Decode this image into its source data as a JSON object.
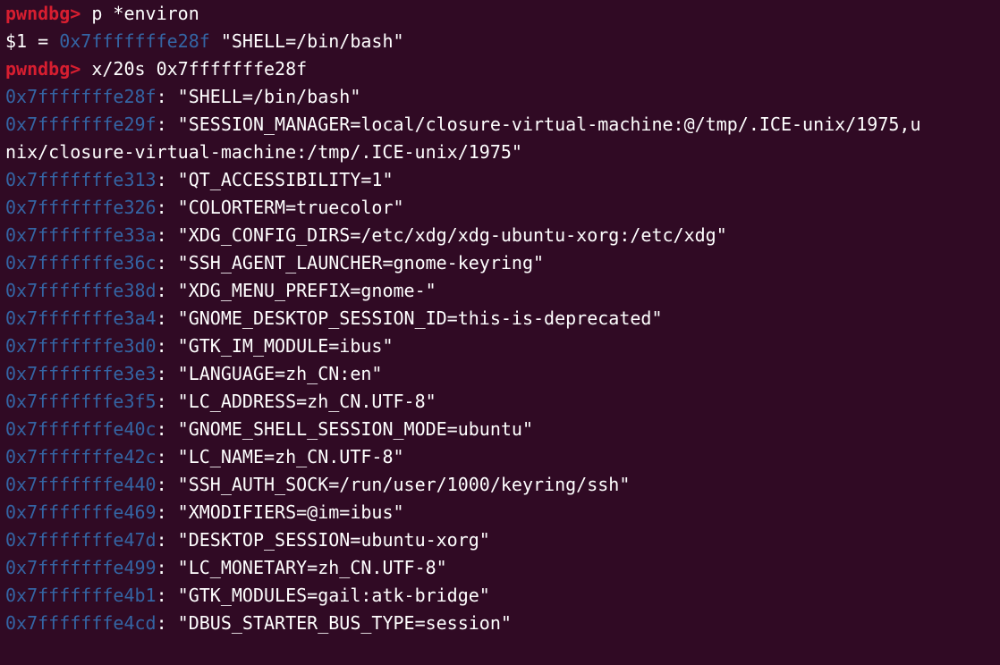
{
  "colors": {
    "background": "#300a24",
    "prompt": "#d71e30",
    "address": "#3465a4",
    "text": "#ffffff"
  },
  "session": [
    {
      "kind": "prompt",
      "prompt": "pwndbg> ",
      "command": "p *environ"
    },
    {
      "kind": "result",
      "prefix": "$1 = ",
      "addr": "0x7fffffffe28f",
      "value": " \"SHELL=/bin/bash\""
    },
    {
      "kind": "prompt",
      "prompt": "pwndbg> ",
      "command": "x/20s 0x7fffffffe28f"
    }
  ],
  "strings": [
    {
      "addr": "0x7fffffffe28f",
      "text": ": \"SHELL=/bin/bash\""
    },
    {
      "addr": "0x7fffffffe29f",
      "text": ": \"SESSION_MANAGER=local/closure-virtual-machine:@/tmp/.ICE-unix/1975,u"
    },
    {
      "addr": "",
      "text": "nix/closure-virtual-machine:/tmp/.ICE-unix/1975\""
    },
    {
      "addr": "0x7fffffffe313",
      "text": ": \"QT_ACCESSIBILITY=1\""
    },
    {
      "addr": "0x7fffffffe326",
      "text": ": \"COLORTERM=truecolor\""
    },
    {
      "addr": "0x7fffffffe33a",
      "text": ": \"XDG_CONFIG_DIRS=/etc/xdg/xdg-ubuntu-xorg:/etc/xdg\""
    },
    {
      "addr": "0x7fffffffe36c",
      "text": ": \"SSH_AGENT_LAUNCHER=gnome-keyring\""
    },
    {
      "addr": "0x7fffffffe38d",
      "text": ": \"XDG_MENU_PREFIX=gnome-\""
    },
    {
      "addr": "0x7fffffffe3a4",
      "text": ": \"GNOME_DESKTOP_SESSION_ID=this-is-deprecated\""
    },
    {
      "addr": "0x7fffffffe3d0",
      "text": ": \"GTK_IM_MODULE=ibus\""
    },
    {
      "addr": "0x7fffffffe3e3",
      "text": ": \"LANGUAGE=zh_CN:en\""
    },
    {
      "addr": "0x7fffffffe3f5",
      "text": ": \"LC_ADDRESS=zh_CN.UTF-8\""
    },
    {
      "addr": "0x7fffffffe40c",
      "text": ": \"GNOME_SHELL_SESSION_MODE=ubuntu\""
    },
    {
      "addr": "0x7fffffffe42c",
      "text": ": \"LC_NAME=zh_CN.UTF-8\""
    },
    {
      "addr": "0x7fffffffe440",
      "text": ": \"SSH_AUTH_SOCK=/run/user/1000/keyring/ssh\""
    },
    {
      "addr": "0x7fffffffe469",
      "text": ": \"XMODIFIERS=@im=ibus\""
    },
    {
      "addr": "0x7fffffffe47d",
      "text": ": \"DESKTOP_SESSION=ubuntu-xorg\""
    },
    {
      "addr": "0x7fffffffe499",
      "text": ": \"LC_MONETARY=zh_CN.UTF-8\""
    },
    {
      "addr": "0x7fffffffe4b1",
      "text": ": \"GTK_MODULES=gail:atk-bridge\""
    },
    {
      "addr": "0x7fffffffe4cd",
      "text": ": \"DBUS_STARTER_BUS_TYPE=session\""
    }
  ]
}
